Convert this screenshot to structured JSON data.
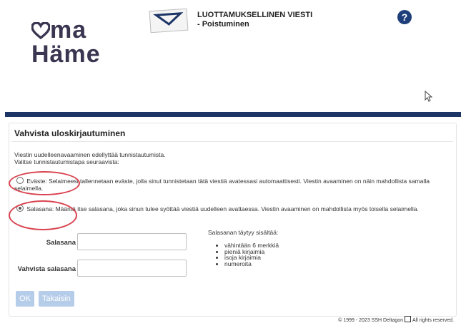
{
  "brand": {
    "logo_line1": "ma",
    "logo_line2": "Häme"
  },
  "header": {
    "title": "LUOTTAMUKSELLINEN VIESTI",
    "subtitle": "- Poistuminen",
    "help_icon": "?"
  },
  "panel": {
    "title": "Vahvista uloskirjautuminen",
    "intro_line1": "Viestin uudelleenavaaminen edellyttää tunnistautumista.",
    "intro_line2": "Valitse tunnistautumistapa seuraavista:",
    "options": [
      {
        "label": "Eväste:",
        "text": "Selaimeesi tallennetaan eväste, jolla sinut tunnistetaan tätä viestiä avatessasi automaattisesti. Viestin avaaminen on näin mahdollista samalla selaimella.",
        "checked": false
      },
      {
        "label": "Salasana:",
        "text": "Määritä itse salasana, joka sinun tulee syöttää viestiä uudelleen avattaessa. Viestin avaaminen on mahdollista myös toisella selaimella.",
        "checked": true
      }
    ],
    "password_label": "Salasana",
    "confirm_label": "Vahvista salasana",
    "password_value": "",
    "confirm_value": "",
    "requirements_title": "Salasanan täytyy sisältää:",
    "requirements": [
      "vähintään 6 merkkiä",
      "pieniä kirjaimia",
      "isoja kirjaimia",
      "numeroita"
    ],
    "ok_label": "OK",
    "back_label": "Takaisin"
  },
  "footer": {
    "left": "© 1999 - 2023 SSH Deltagon",
    "right": "All rights reserved."
  },
  "colors": {
    "brand_navy": "#1c3566",
    "button": "#b6cdea",
    "highlight": "#d9434f",
    "logo": "#3a3550"
  }
}
